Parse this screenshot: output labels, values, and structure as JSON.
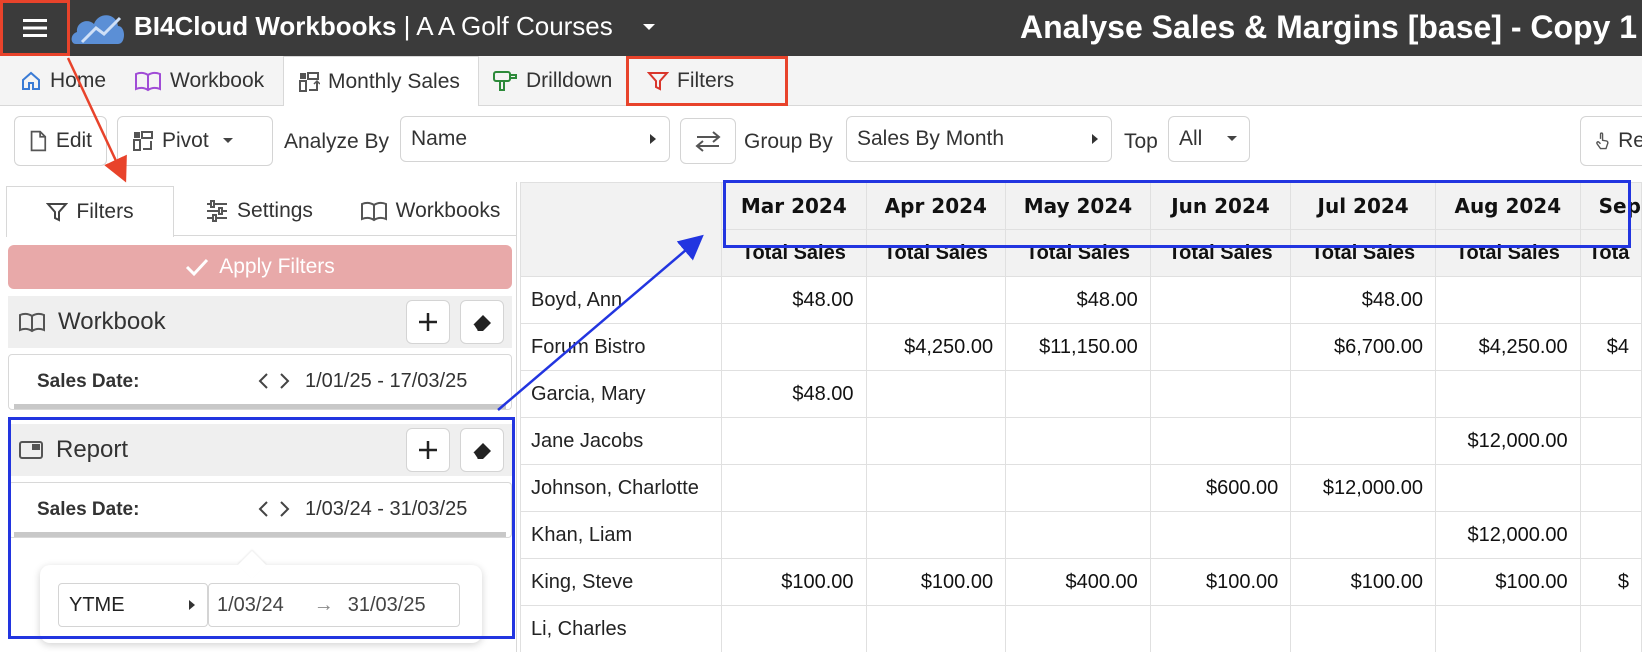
{
  "app": {
    "brand": "BI4Cloud Workbooks",
    "separator": " | ",
    "company": "A A Golf Courses",
    "report_title": "Analyse Sales & Margins [base] - Copy 1"
  },
  "tabs": [
    {
      "label": "Home",
      "icon": "home-icon"
    },
    {
      "label": "Workbook",
      "icon": "book-icon"
    },
    {
      "label": "Monthly Sales",
      "icon": "pivot-icon",
      "active": true
    },
    {
      "label": "Drilldown",
      "icon": "drill-icon"
    },
    {
      "label": "Filters",
      "icon": "filter-icon",
      "highlighted": true
    }
  ],
  "toolbar": {
    "edit": "Edit",
    "pivot": "Pivot",
    "analyze_by_label": "Analyze By",
    "analyze_by_value": "Name",
    "group_by_label": "Group By",
    "group_by_value": "Sales By Month",
    "top_label": "Top",
    "top_value": "All",
    "right_button": "Re"
  },
  "left_panel": {
    "tabs": [
      {
        "label": "Filters",
        "active": true
      },
      {
        "label": "Settings"
      },
      {
        "label": "Workbooks"
      }
    ],
    "apply_filters": "Apply Filters",
    "workbook_section": {
      "title": "Workbook",
      "filter_label": "Sales Date:",
      "filter_value": "1/01/25 - 17/03/25"
    },
    "report_section": {
      "title": "Report",
      "filter_label": "Sales Date:",
      "filter_value": "1/03/24 - 31/03/25"
    },
    "popover": {
      "period": "YTME",
      "from": "1/03/24",
      "arrow": "→",
      "to": "31/03/25"
    }
  },
  "grid": {
    "months": [
      "Mar 2024",
      "Apr 2024",
      "May 2024",
      "Jun 2024",
      "Jul 2024",
      "Aug 2024",
      "Sep"
    ],
    "measure": "Total Sales",
    "measure_partial": "Tota",
    "rows": [
      {
        "name": "Boyd, Ann",
        "values": [
          "$48.00",
          "",
          "$48.00",
          "",
          "$48.00",
          "",
          ""
        ]
      },
      {
        "name": "Forum Bistro",
        "values": [
          "",
          "$4,250.00",
          "$11,150.00",
          "",
          "$6,700.00",
          "$4,250.00",
          "$4"
        ]
      },
      {
        "name": "Garcia, Mary",
        "values": [
          "$48.00",
          "",
          "",
          "",
          "",
          "",
          ""
        ]
      },
      {
        "name": "Jane Jacobs",
        "values": [
          "",
          "",
          "",
          "",
          "",
          "$12,000.00",
          ""
        ]
      },
      {
        "name": "Johnson, Charlotte",
        "values": [
          "",
          "",
          "",
          "$600.00",
          "$12,000.00",
          "",
          ""
        ]
      },
      {
        "name": "Khan, Liam",
        "values": [
          "",
          "",
          "",
          "",
          "",
          "$12,000.00",
          ""
        ]
      },
      {
        "name": "King, Steve",
        "values": [
          "$100.00",
          "$100.00",
          "$400.00",
          "$100.00",
          "$100.00",
          "$100.00",
          "$"
        ]
      },
      {
        "name": "Li, Charles",
        "values": [
          "",
          "",
          "",
          "",
          "",
          "",
          ""
        ]
      }
    ]
  },
  "colors": {
    "topbar": "#3b3b3b",
    "annotation_red": "#e8432b",
    "annotation_blue": "#2235e0",
    "apply_button": "#e8a9a9"
  }
}
